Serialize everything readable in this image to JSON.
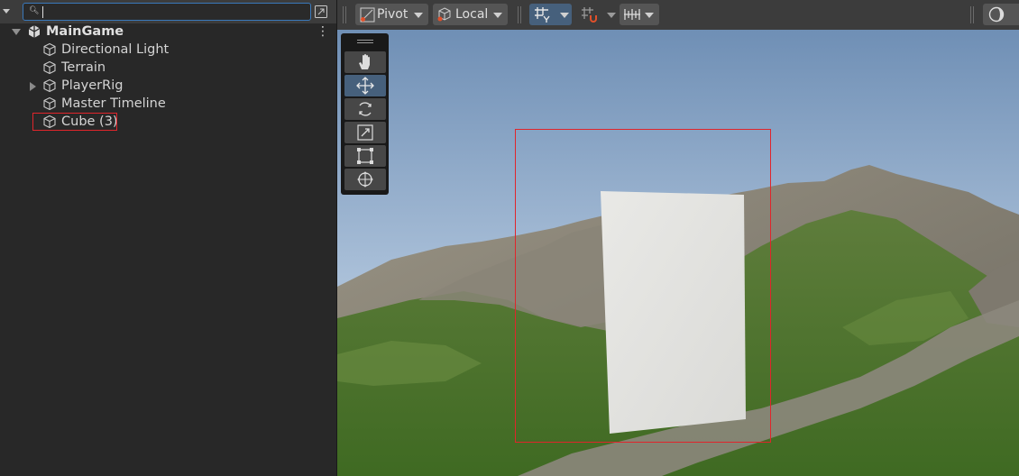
{
  "hierarchy": {
    "search": {
      "placeholder": "",
      "value": ""
    },
    "scene": {
      "name": "MainGame"
    },
    "items": [
      {
        "label": "Directional Light"
      },
      {
        "label": "Terrain"
      },
      {
        "label": "PlayerRig"
      },
      {
        "label": "Master Timeline"
      },
      {
        "label": "Cube (3)"
      }
    ]
  },
  "scene_toolbar": {
    "pivot_label": "Pivot",
    "space_label": "Local"
  },
  "colors": {
    "accent_blue": "#46607c",
    "selection_red": "#e0252b",
    "panel_dark": "#282828"
  }
}
